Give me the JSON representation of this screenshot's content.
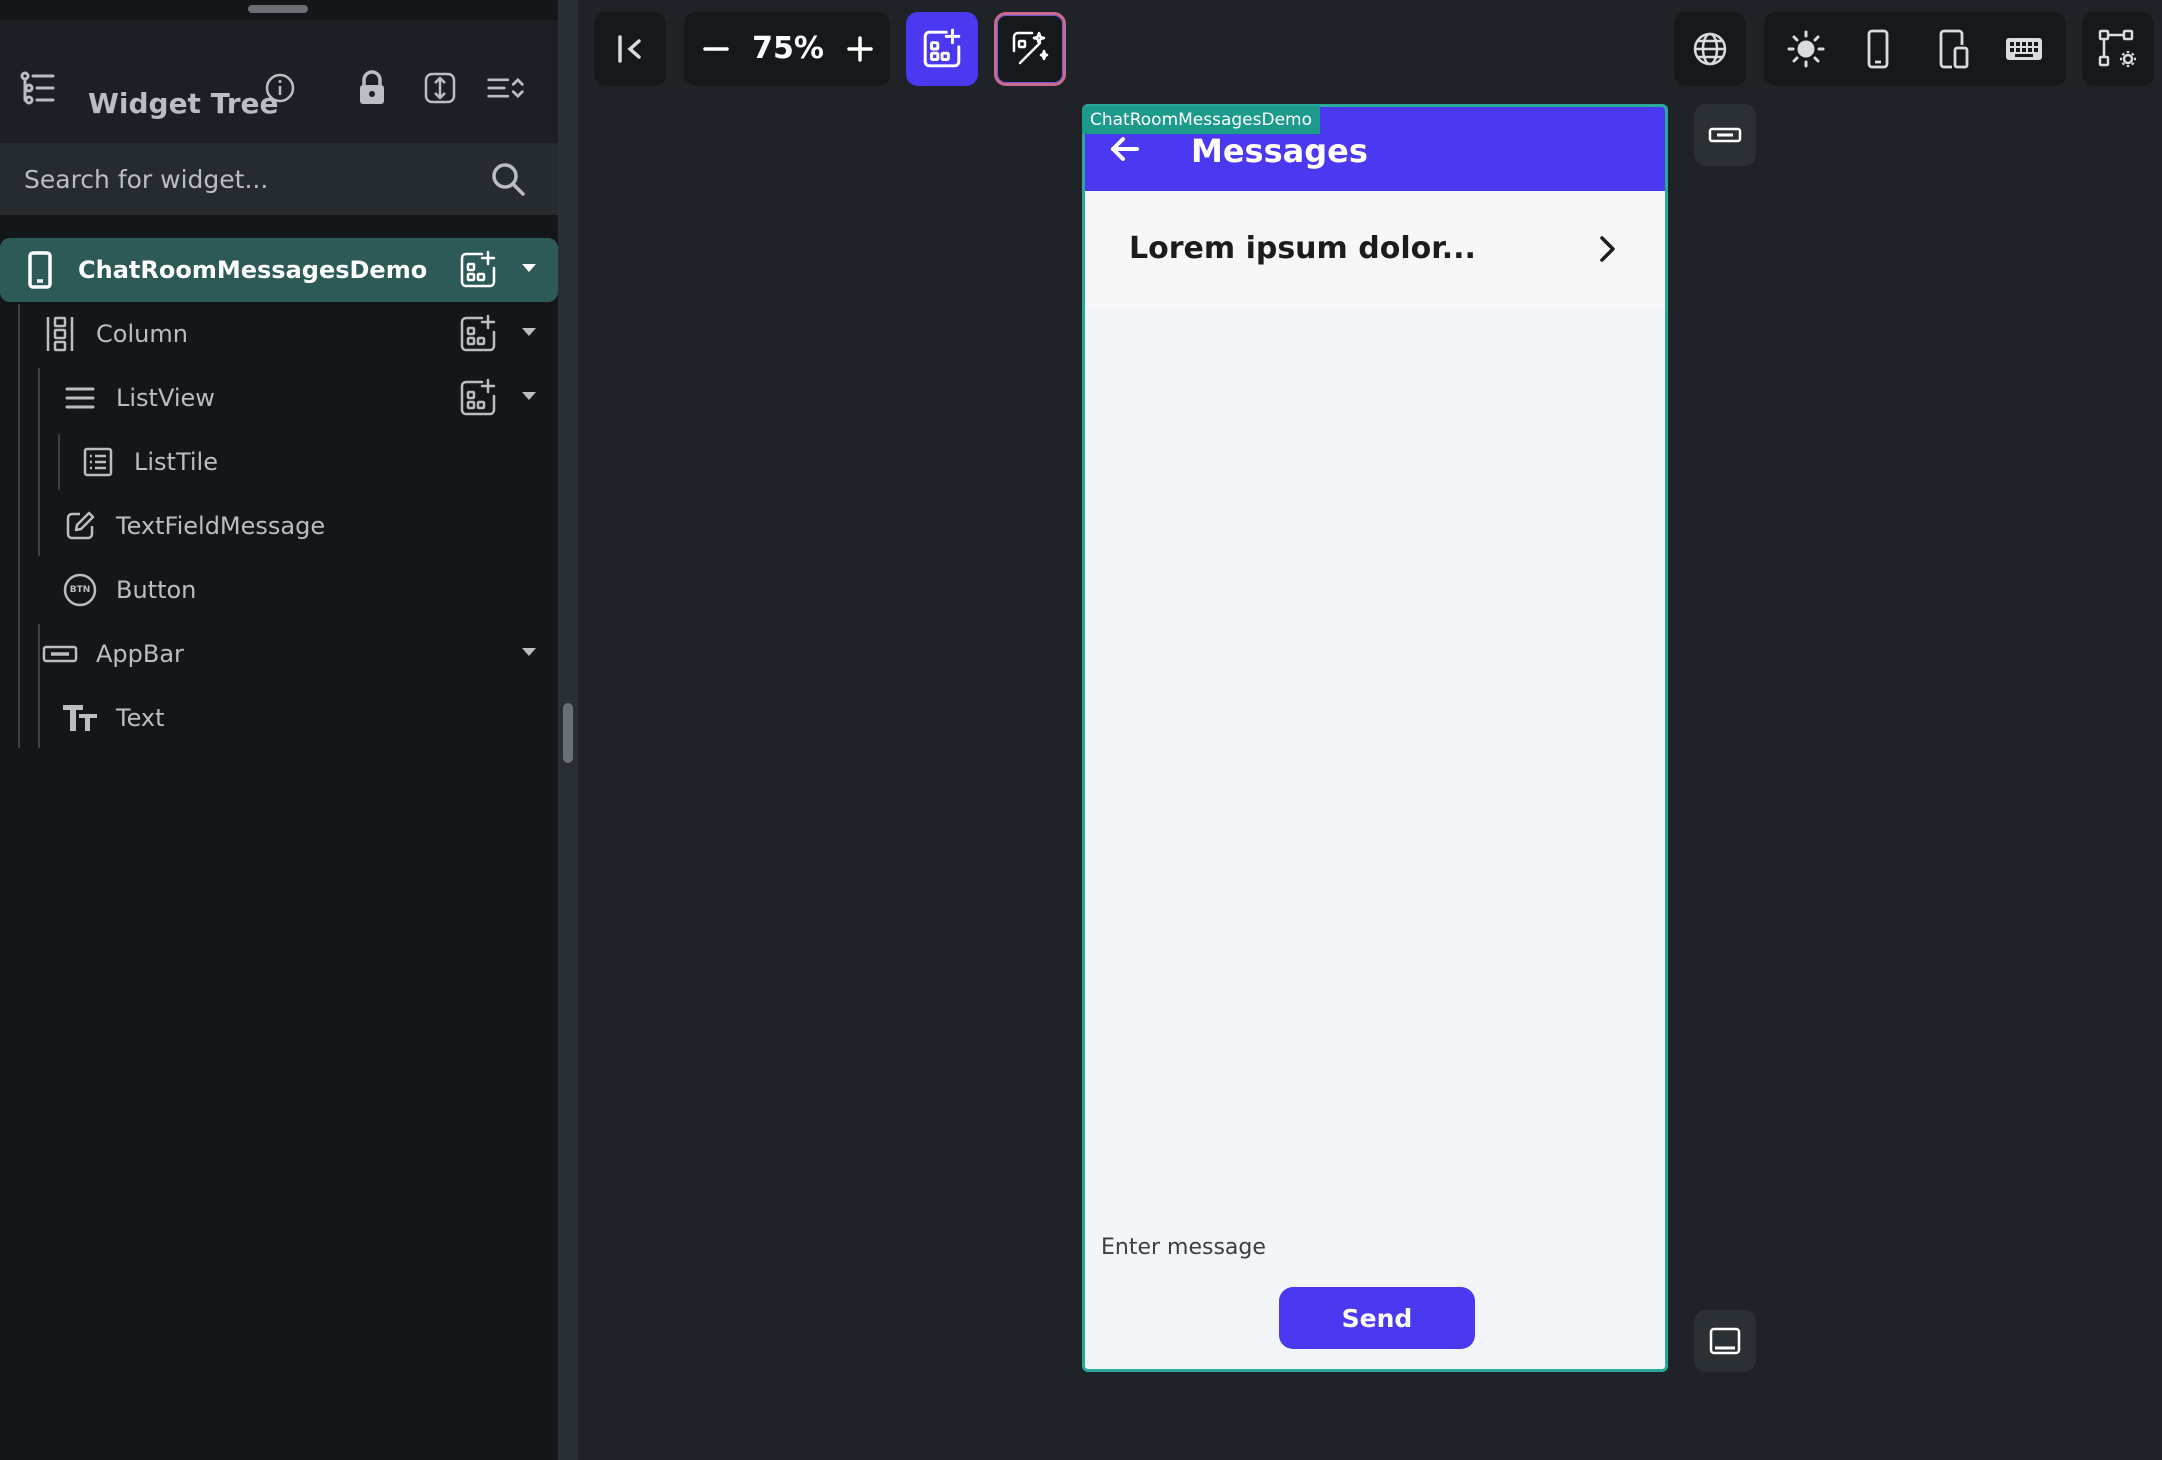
{
  "widget_tree": {
    "title": "Widget Tree",
    "search_placeholder": "Search for widget...",
    "nodes": [
      {
        "label": "ChatRoomMessagesDemo",
        "icon": "phone-icon"
      },
      {
        "label": "Column",
        "icon": "column-icon"
      },
      {
        "label": "ListView",
        "icon": "listview-icon"
      },
      {
        "label": "ListTile",
        "icon": "listtile-icon"
      },
      {
        "label": "TextFieldMessage",
        "icon": "textfield-icon"
      },
      {
        "label": "Button",
        "icon": "button-btn-icon"
      },
      {
        "label": "AppBar",
        "icon": "appbar-icon"
      },
      {
        "label": "Text",
        "icon": "text-icon"
      }
    ],
    "button_icon_text": "BTN"
  },
  "toolbar": {
    "zoom_value": "75%"
  },
  "device": {
    "tag": "ChatRoomMessagesDemo",
    "appbar_title": "Messages",
    "list_tile_title": "Lorem ipsum dolor...",
    "message_placeholder": "Enter message",
    "send_label": "Send"
  },
  "colors": {
    "accent": "#4a39f0",
    "selection": "#2d5a57",
    "device_border": "#2aa89a"
  }
}
